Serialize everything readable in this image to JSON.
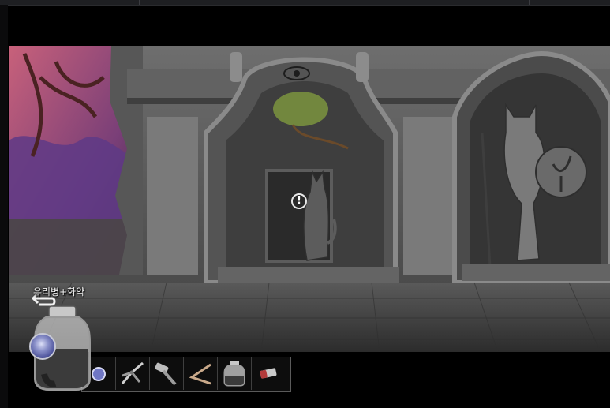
{
  "inventory": {
    "selected_item_label": "유리병+화약",
    "slots": [
      {
        "icon": "blue-orb-icon"
      },
      {
        "icon": "pliers-icon"
      },
      {
        "icon": "hammer-icon"
      },
      {
        "icon": "bent-rod-icon"
      },
      {
        "icon": "glass-jar-icon"
      },
      {
        "icon": "eraser-icon"
      }
    ]
  },
  "scene": {
    "hint_marker": "!"
  },
  "colors": {
    "stone": "#6d6d6d",
    "dark_stone": "#3a3a3a",
    "tree_pink": "#c05a73",
    "tree_purple": "#5e3a86",
    "moss_green": "#7f9a3f",
    "orb_blue": "#6f76c4"
  }
}
